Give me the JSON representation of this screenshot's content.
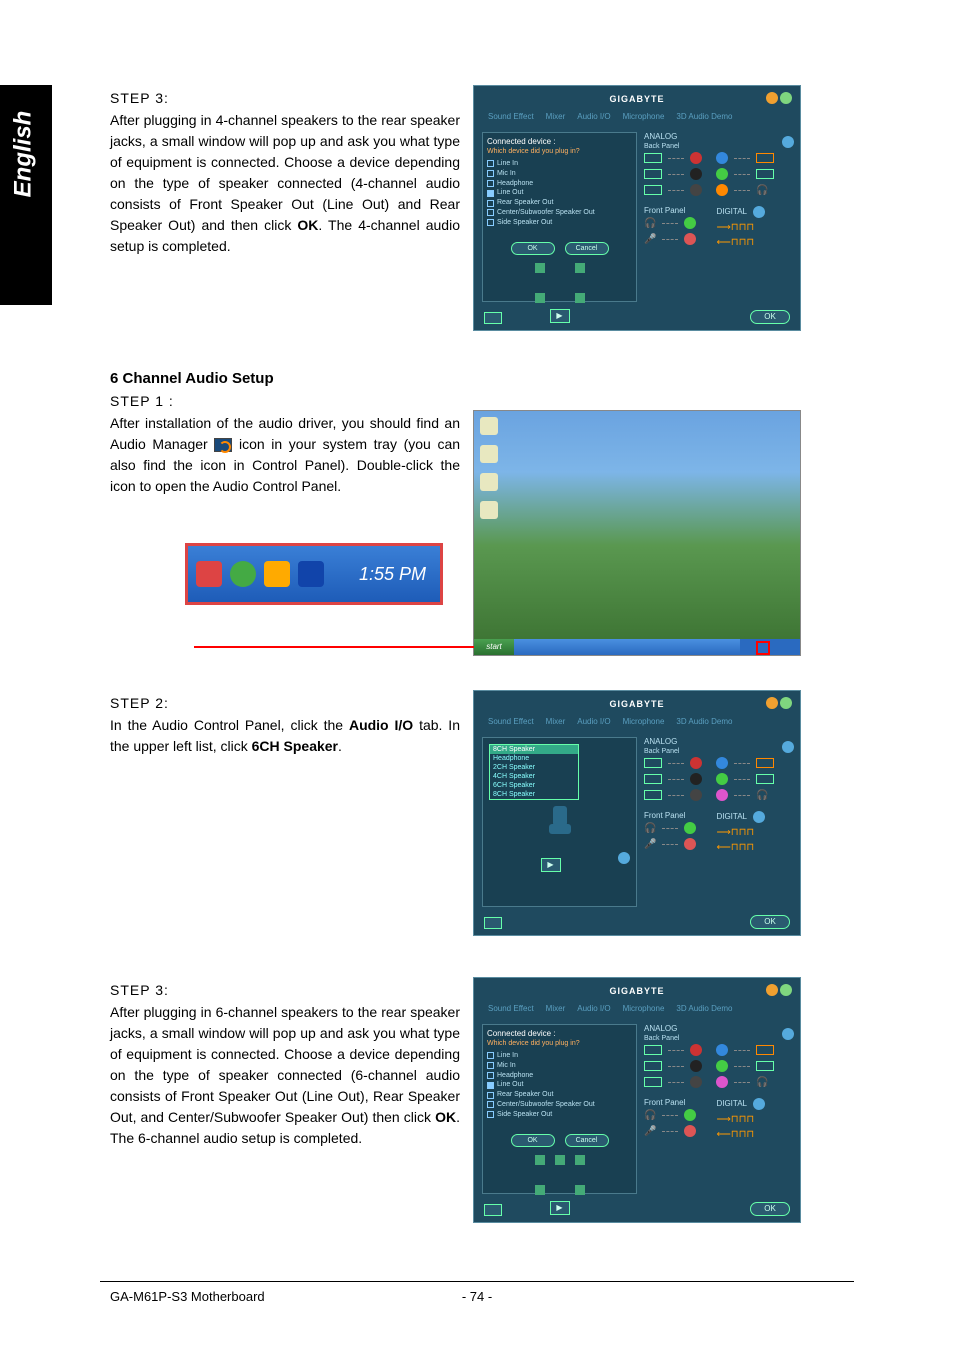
{
  "sideTab": "English",
  "sec1": {
    "step": "STEP 3:",
    "text_before": "After plugging in 4-channel speakers to the rear speaker jacks, a small window will pop up and ask you what type of equipment is connected. Choose a device depending on the type of speaker connected (4-channel audio consists of Front Speaker Out (Line Out) and Rear Speaker Out) and then click ",
    "bold": "OK",
    "text_after": ". The 4-channel audio setup is completed."
  },
  "heading6ch": "6 Channel Audio Setup",
  "sec2step1": {
    "step": "STEP 1 :",
    "text_a": "After installation of the audio driver, you should find an Audio Manager",
    "text_b": "icon in your system tray (you can also find the icon in Control Panel).  Double-click the icon to open the Audio Control Panel."
  },
  "systray": {
    "time": "1:55 PM"
  },
  "sec2step2": {
    "step": "STEP 2:",
    "t1": "In the Audio Control Panel, click the ",
    "b1": "Audio I/O",
    "t2": " tab. In the upper left list, click ",
    "b2": "6CH Speaker",
    "t3": "."
  },
  "sec2step3": {
    "step": "STEP 3:",
    "t1": "After plugging in 6-channel speakers to the rear speaker jacks, a small window will pop up and ask you what type of equipment is connected. Choose a device depending on the type of speaker connected (6-channel audio consists of Front Speaker Out (Line Out), Rear Speaker Out, and Center/Subwoofer Speaker Out) then click ",
    "b1": "OK",
    "t2": ". The 6-channel audio setup is completed."
  },
  "panel": {
    "logo": "GIGABYTE",
    "tabs": [
      "Sound Effect",
      "Mixer",
      "Audio I/O",
      "Microphone",
      "3D Audio Demo"
    ],
    "analog": "ANALOG",
    "backPanel": "Back Panel",
    "frontPanel": "Front Panel",
    "digital": "DIGITAL",
    "ok": "OK",
    "cancel": "Cancel",
    "connected": "Connected device :",
    "question": "Which device did you plug in?",
    "devices": [
      "Line In",
      "Mic In",
      "Headphone",
      "Line Out",
      "Rear Speaker Out",
      "Center/Subwoofer Speaker Out",
      "Side Speaker Out"
    ],
    "checked4ch": 3,
    "checked6ch": 5,
    "dropdown": [
      "Headphone",
      "2CH Speaker",
      "4CH Speaker",
      "6CH Speaker",
      "8CH Speaker"
    ],
    "dropdownSel": "8CH Speaker"
  },
  "desktop": {
    "start": "start"
  },
  "footer": {
    "left": "GA-M61P-S3 Motherboard",
    "page": "- 74 -"
  }
}
